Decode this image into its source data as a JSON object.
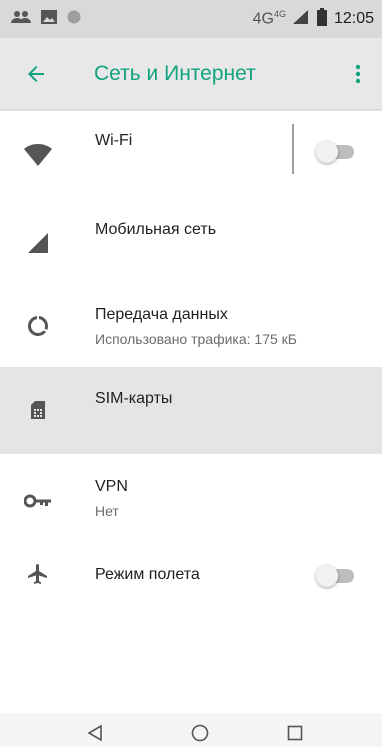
{
  "status_bar": {
    "network": "4G",
    "network_sup": "4G",
    "time": "12:05",
    "icons": [
      "people-icon",
      "image-icon",
      "circle-icon",
      "signal-icon",
      "battery-icon"
    ]
  },
  "app_bar": {
    "title": "Сеть и Интернет",
    "back_icon": "arrow-back-icon",
    "overflow_icon": "more-vert-icon",
    "accent_color": "#13a37f"
  },
  "items": [
    {
      "title": "Wi-Fi",
      "subtitle": "",
      "icon": "wifi-icon",
      "toggle": true,
      "toggle_on": false
    },
    {
      "title": "Мобильная сеть",
      "subtitle": "",
      "icon": "cell-signal-icon"
    },
    {
      "title": "Передача данных",
      "subtitle": "Использовано трафика: 175 кБ",
      "icon": "data-usage-icon"
    },
    {
      "title": "SIM-карты",
      "subtitle": "",
      "icon": "sim-card-icon",
      "selected": true
    },
    {
      "title": "VPN",
      "subtitle": "Нет",
      "icon": "vpn-key-icon"
    },
    {
      "title": "Режим полета",
      "subtitle": "",
      "icon": "airplane-icon",
      "toggle": true,
      "toggle_on": false
    }
  ],
  "nav_bar": {
    "icons": [
      "back-triangle-icon",
      "home-circle-icon",
      "recents-square-icon"
    ]
  }
}
